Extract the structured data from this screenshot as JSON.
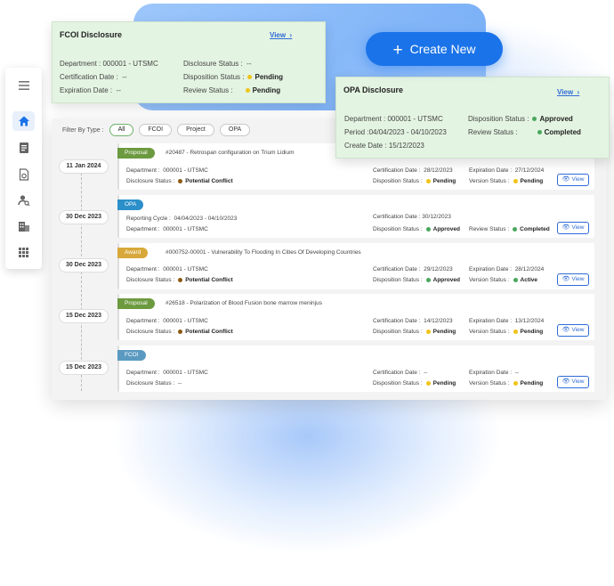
{
  "create_button": {
    "label": "Create New",
    "icon": "plus-icon"
  },
  "fcoi_card": {
    "title": "FCOI Disclosure",
    "view_label": "View",
    "department_label": "Department :",
    "department_value": "000001 - UTSMC",
    "certification_label": "Certification Date :",
    "certification_value": "--",
    "expiration_label": "Expiration Date :",
    "expiration_value": "--",
    "disclosure_status_label": "Disclosure Status :",
    "disclosure_status_value": "--",
    "disposition_status_label": "Disposition Status :",
    "disposition_status_value": "Pending",
    "review_status_label": "Review Status :",
    "review_status_value": "Pending"
  },
  "opa_card": {
    "title": "OPA Disclosure",
    "view_label": "View",
    "department_label": "Department :",
    "department_value": "000001 - UTSMC",
    "period_label": "Period :",
    "period_value": "04/04/2023 - 04/10/2023",
    "create_label": "Create Date :",
    "create_value": "15/12/2023",
    "disposition_status_label": "Disposition Status :",
    "disposition_status_value": "Approved",
    "review_status_label": "Review Status :",
    "review_status_value": "Completed"
  },
  "sidenav": {
    "items": [
      "menu-icon",
      "home-icon",
      "document-icon",
      "file-settings-icon",
      "user-search-icon",
      "building-icon",
      "apps-grid-icon"
    ]
  },
  "filter": {
    "label": "Filter By Type :",
    "options": [
      "All",
      "FCOI",
      "Project",
      "OPA"
    ],
    "selected": "All"
  },
  "timeline": [
    {
      "date": "11 Jan 2024",
      "type": "Proposal",
      "title": "#20487 - Retrospan configuration on Trium Lidium",
      "rows": [
        [
          "Department :",
          "000001 - UTSMC",
          "Certification Date :",
          "28/12/2023",
          "Expiration Date :",
          "27/12/2024"
        ],
        [
          "Disclosure Status :",
          "Potential Conflict",
          "Disposition Status :",
          "Pending",
          "Version Status :",
          "Pending"
        ]
      ]
    },
    {
      "date": "30 Dec 2023",
      "type": "OPA",
      "rows": [
        [
          "Reporting Cycle :",
          "04/04/2023 - 04/10/2023",
          "Certification Date :",
          "30/12/2023"
        ],
        [
          "Department :",
          "000001 - UTSMC",
          "Disposition Status :",
          "Approved",
          "Review Status :",
          "Completed"
        ]
      ]
    },
    {
      "date": "30 Dec 2023",
      "type": "Award",
      "title": "#000752-00001 - Vulnerability To Flooding In Cities Of Developing Countries",
      "rows": [
        [
          "Department :",
          "000001 - UTSMC",
          "Certification Date :",
          "29/12/2023",
          "Expiration Date :",
          "28/12/2024"
        ],
        [
          "Disclosure Status :",
          "Potential Conflict",
          "Disposition Status :",
          "Approved",
          "Version Status :",
          "Active"
        ]
      ]
    },
    {
      "date": "15 Dec 2023",
      "type": "Proposal",
      "title": "#26518 - Polarization of Blood Fusion bone marrow meninjus",
      "rows": [
        [
          "Department :",
          "000001 - UTSMC",
          "Certification Date :",
          "14/12/2023",
          "Expiration Date :",
          "13/12/2024"
        ],
        [
          "Disclosure Status :",
          "Potential Conflict",
          "Disposition Status :",
          "Pending",
          "Version Status :",
          "Pending"
        ]
      ]
    },
    {
      "date": "15 Dec 2023",
      "type": "FCOI",
      "rows": [
        [
          "Department :",
          "000001 - UTSMC",
          "Certification Date :",
          "--",
          "Expiration Date :",
          "--"
        ],
        [
          "Disclosure Status :",
          "--",
          "Disposition Status :",
          "Pending",
          "Version Status :",
          "Pending"
        ]
      ]
    }
  ],
  "view_label": "View",
  "colors": {
    "accent": "#1a73e8",
    "card_bg": "#e4f4e2",
    "pending": "#f0c419",
    "approved": "#49a75e",
    "conflict": "#8b5a12"
  }
}
